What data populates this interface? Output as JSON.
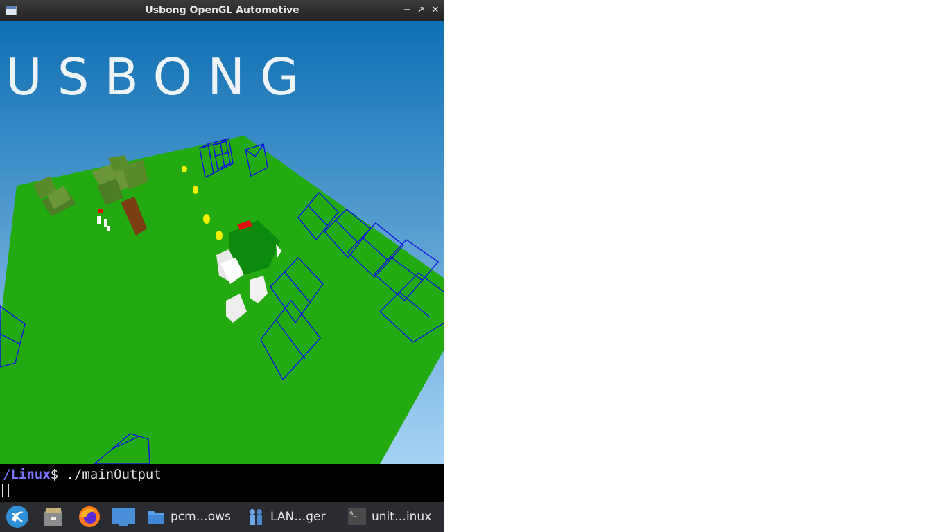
{
  "window": {
    "title": "Usbong OpenGL Automotive"
  },
  "scene": {
    "logo_text": "USBONG",
    "sky_top": "#0f6fb3",
    "sky_bottom": "#a7d3f4",
    "ground_color": "#22aa10",
    "wire_color": "#1010e0"
  },
  "terminal": {
    "prompt_path": "/Linux",
    "prompt_symbol": "$",
    "command": " ./mainOutput"
  },
  "taskbar": {
    "items": [
      {
        "label": "pcm…ows",
        "icon": "folder-icon"
      },
      {
        "label": "LAN…ger",
        "icon": "network-manager-icon"
      },
      {
        "label": "unit…inux",
        "icon": "terminal-icon"
      }
    ]
  }
}
